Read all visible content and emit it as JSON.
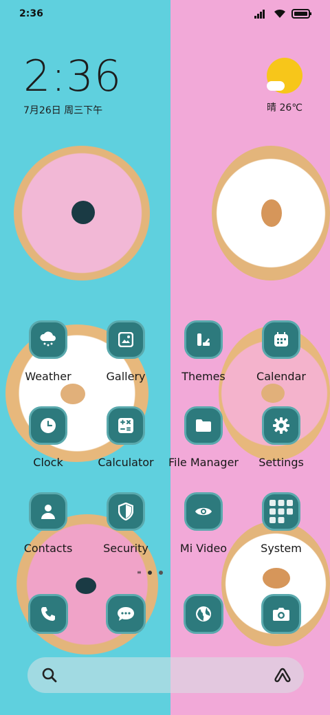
{
  "status_bar": {
    "time": "2:36"
  },
  "clock_widget": {
    "time": "2:36",
    "date": "7月26日 周三下午"
  },
  "weather_widget": {
    "temp": "晴 26℃",
    "icon": "sun-cloud-icon"
  },
  "apps": [
    {
      "name": "Weather",
      "icon": "cloud-rain-icon"
    },
    {
      "name": "Gallery",
      "icon": "image-icon"
    },
    {
      "name": "Themes",
      "icon": "palette-icon"
    },
    {
      "name": "Calendar",
      "icon": "calendar-icon"
    },
    {
      "name": "Clock",
      "icon": "clock-icon"
    },
    {
      "name": "Calculator",
      "icon": "calculator-icon"
    },
    {
      "name": "File Manager",
      "icon": "folder-icon"
    },
    {
      "name": "Settings",
      "icon": "gear-icon"
    },
    {
      "name": "Contacts",
      "icon": "person-icon"
    },
    {
      "name": "Security",
      "icon": "shield-icon"
    },
    {
      "name": "Mi Video",
      "icon": "eye-icon"
    },
    {
      "name": "System",
      "icon": "folder-grid-icon"
    }
  ],
  "dock": [
    {
      "icon": "phone-icon"
    },
    {
      "icon": "chat-icon"
    },
    {
      "icon": "globe-icon"
    },
    {
      "icon": "camera-icon"
    }
  ],
  "search_bar": {
    "icon_left": "search-icon",
    "icon_right": "assistant-icon"
  },
  "colors": {
    "tile": "#2d7a7d",
    "left_bg": "#5fd0de",
    "right_bg": "#f2a9d8"
  }
}
